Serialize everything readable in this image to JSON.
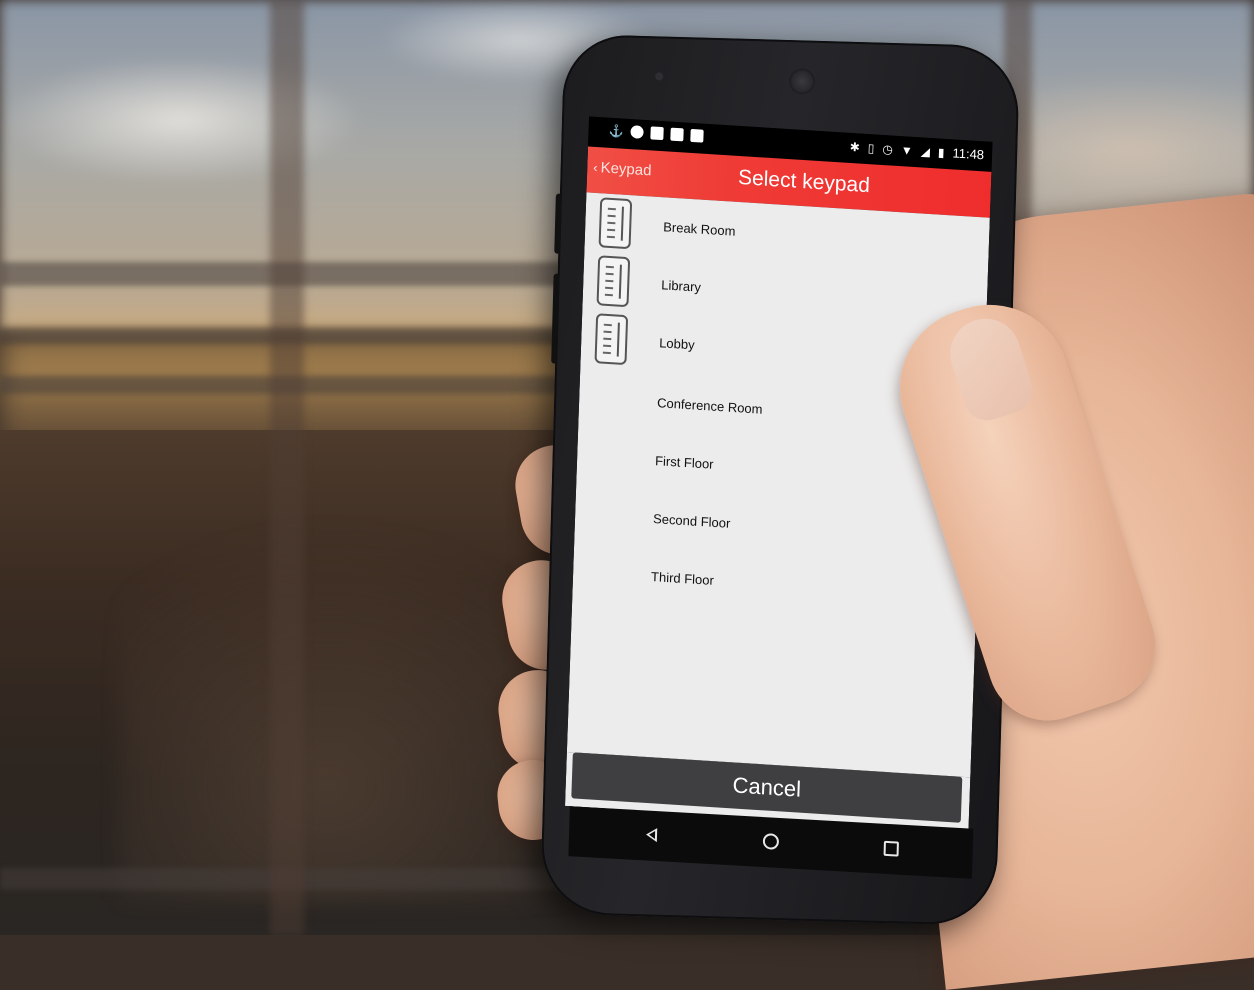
{
  "status_bar": {
    "time": "11:48",
    "left_icons": [
      "usb-debug-icon",
      "messenger-icon",
      "youtube-icon",
      "gallery-icon",
      "clipboard-icon"
    ],
    "right_icons": [
      "bluetooth-icon",
      "vibrate-icon",
      "alarm-icon",
      "wifi-icon",
      "signal-icon",
      "battery-icon"
    ]
  },
  "app_bar": {
    "back_label": "Keypad",
    "title": "Select keypad",
    "color": "#ef3b36"
  },
  "keypads": [
    {
      "label": "Break Room",
      "has_icon": true
    },
    {
      "label": "Library",
      "has_icon": true
    },
    {
      "label": "Lobby",
      "has_icon": true
    },
    {
      "label": "Conference Room",
      "has_icon": false
    },
    {
      "label": "First Floor",
      "has_icon": false
    },
    {
      "label": "Second Floor",
      "has_icon": false
    },
    {
      "label": "Third Floor",
      "has_icon": false
    }
  ],
  "cancel_button": {
    "label": "Cancel",
    "color": "#3f3f41"
  },
  "nav_bar": {
    "icons": [
      "back-triangle-icon",
      "home-circle-icon",
      "recents-square-icon"
    ]
  }
}
